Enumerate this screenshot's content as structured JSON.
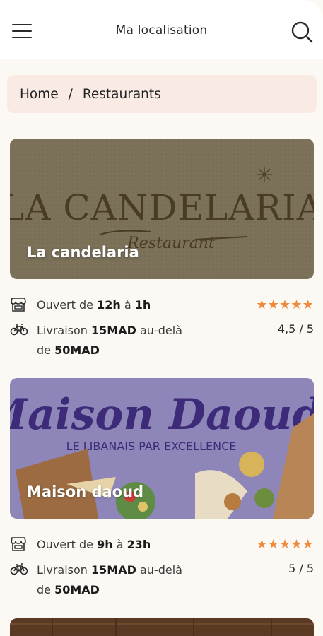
{
  "header": {
    "title": "Ma localisation",
    "menu_icon": "hamburger-menu-icon",
    "search_icon": "search-icon"
  },
  "breadcrumb": {
    "home": "Home",
    "separator": "/",
    "current": "Restaurants"
  },
  "colors": {
    "accent": "#f08a3c",
    "breadcrumb_bg": "#f9ebe4",
    "page_bg": "#fcf9f4"
  },
  "restaurants": [
    {
      "name": "La candelaria",
      "logo_text": "LA CANDELARIA",
      "logo_subtext": "Restaurant",
      "open_label": "Ouvert de",
      "open_from": "12h",
      "open_sep": "à",
      "open_to": "1h",
      "delivery_label": "Livraison",
      "delivery_fee": "15MAD",
      "delivery_beyond": "au-delà",
      "delivery_of": "de",
      "delivery_min": "50MAD",
      "rating": "4,5 / 5",
      "rating_value": 4.5
    },
    {
      "name": "Maison daoud",
      "logo_text": "Maison Daoud",
      "logo_subtext": "LE LIBANAIS PAR EXCELLENCE",
      "open_label": "Ouvert de",
      "open_from": "9h",
      "open_sep": "à",
      "open_to": "23h",
      "delivery_label": "Livraison",
      "delivery_fee": "15MAD",
      "delivery_beyond": "au-delà",
      "delivery_of": "de",
      "delivery_min": "50MAD",
      "rating": "5 / 5",
      "rating_value": 5
    }
  ]
}
